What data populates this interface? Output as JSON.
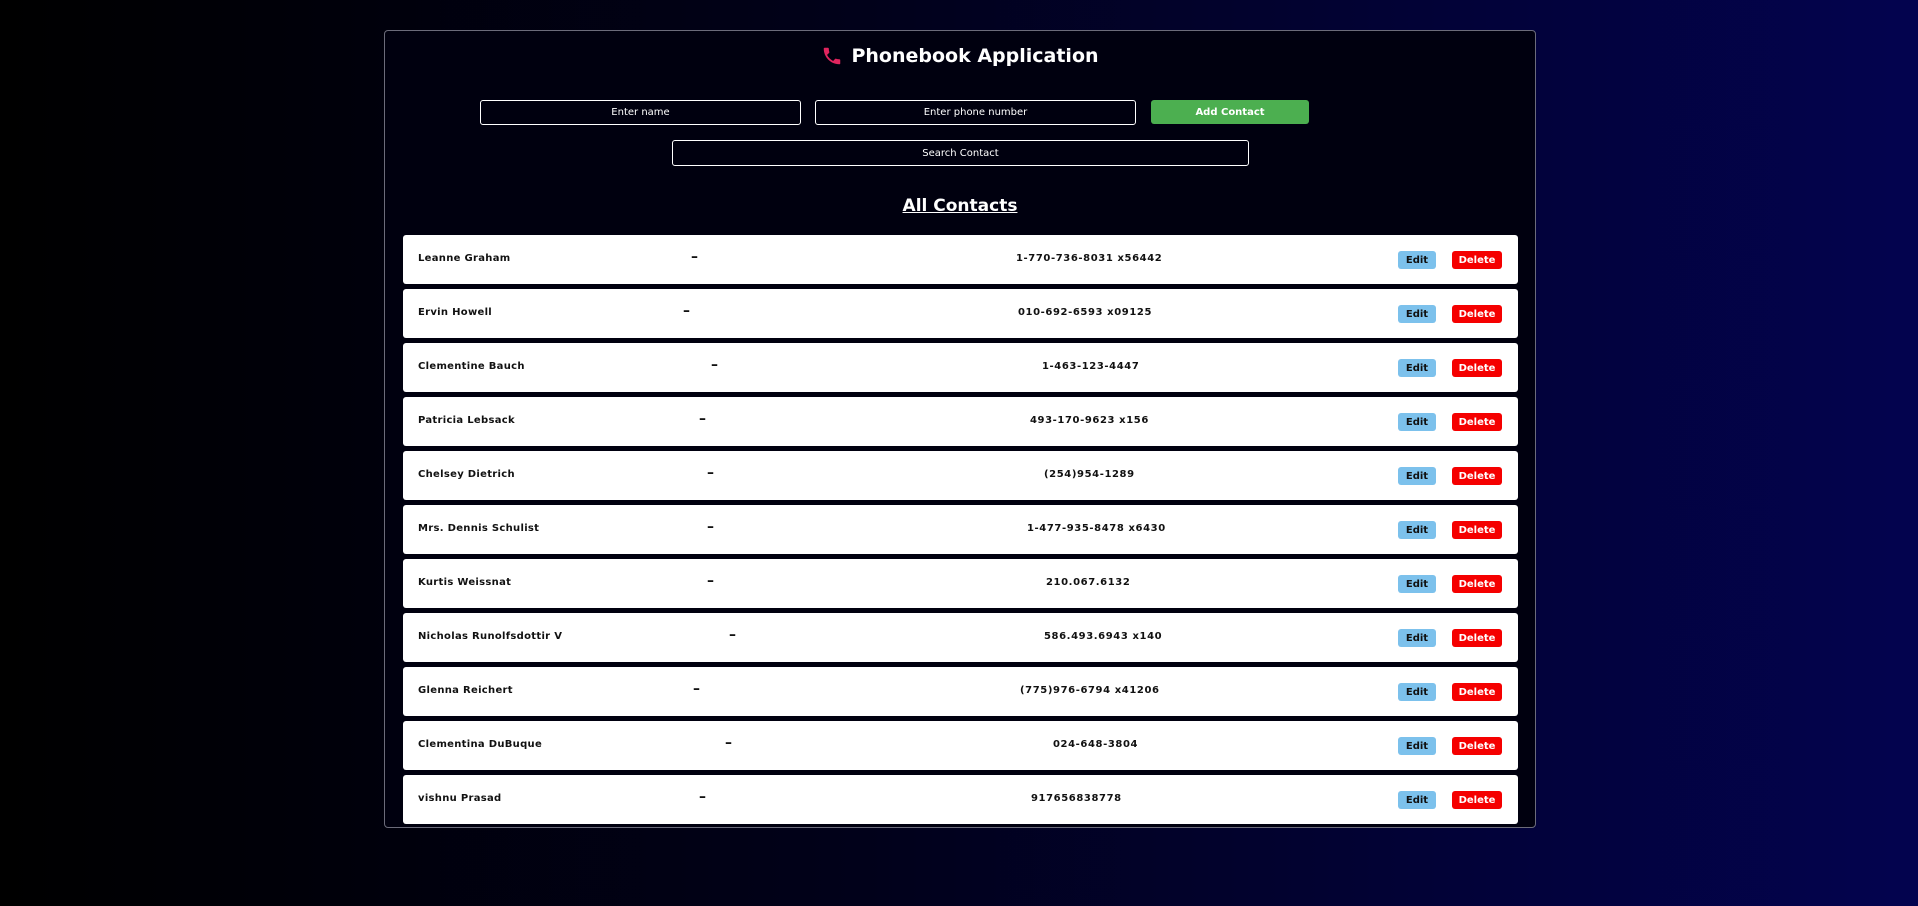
{
  "app": {
    "title": "Phonebook Application",
    "title_icon": "phone-icon"
  },
  "form": {
    "name_placeholder": "Enter name",
    "phone_placeholder": "Enter phone number",
    "add_label": "Add Contact",
    "search_placeholder": "Search Contact"
  },
  "contacts_heading": "All Contacts",
  "separator": "–",
  "edit_label": "Edit",
  "delete_label": "Delete",
  "colors": {
    "accent_icon": "#e0245e",
    "add_button": "#4caf50",
    "edit_button": "#7cc1ec",
    "delete_button": "#f50000"
  },
  "contacts": [
    {
      "name": "Leanne Graham",
      "phone": "1-770-736-8031 x56442"
    },
    {
      "name": "Ervin Howell",
      "phone": "010-692-6593 x09125"
    },
    {
      "name": "Clementine Bauch",
      "phone": "1-463-123-4447"
    },
    {
      "name": "Patricia Lebsack",
      "phone": "493-170-9623 x156"
    },
    {
      "name": "Chelsey Dietrich",
      "phone": "(254)954-1289"
    },
    {
      "name": "Mrs. Dennis Schulist",
      "phone": "1-477-935-8478 x6430"
    },
    {
      "name": "Kurtis Weissnat",
      "phone": "210.067.6132"
    },
    {
      "name": "Nicholas Runolfsdottir V",
      "phone": "586.493.6943 x140"
    },
    {
      "name": "Glenna Reichert",
      "phone": "(775)976-6794 x41206"
    },
    {
      "name": "Clementina DuBuque",
      "phone": "024-648-3804"
    },
    {
      "name": "vishnu Prasad",
      "phone": "917656838778"
    }
  ]
}
